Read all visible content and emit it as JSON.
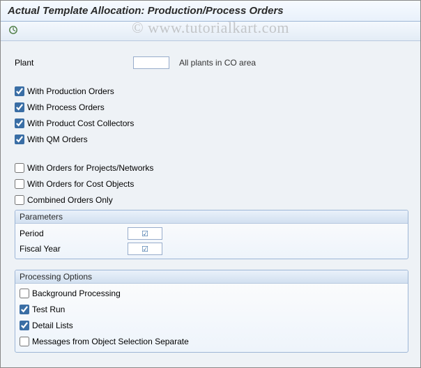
{
  "title": "Actual Template Allocation: Production/Process Orders",
  "watermark": "© www.tutorialkart.com",
  "toolbar": {
    "execute_icon": "execute-icon"
  },
  "fields": {
    "plant_label": "Plant",
    "plant_value": "",
    "plant_hint": "All plants in CO area"
  },
  "orderTypeCheckboxes": [
    {
      "label": "With Production Orders",
      "checked": true
    },
    {
      "label": "With Process Orders",
      "checked": true
    },
    {
      "label": "With Product Cost Collectors",
      "checked": true
    },
    {
      "label": "With QM Orders",
      "checked": true
    }
  ],
  "otherCheckboxes": [
    {
      "label": "With Orders for Projects/Networks",
      "checked": false
    },
    {
      "label": "With Orders for Cost Objects",
      "checked": false
    },
    {
      "label": "Combined Orders Only",
      "checked": false
    }
  ],
  "groups": {
    "parameters": {
      "title": "Parameters",
      "rows": [
        {
          "label": "Period",
          "required": true
        },
        {
          "label": "Fiscal Year",
          "required": true
        }
      ]
    },
    "processing": {
      "title": "Processing Options",
      "rows": [
        {
          "label": "Background Processing",
          "checked": false
        },
        {
          "label": "Test Run",
          "checked": true
        },
        {
          "label": "Detail Lists",
          "checked": true
        },
        {
          "label": "Messages from Object Selection Separate",
          "checked": false
        }
      ]
    }
  }
}
